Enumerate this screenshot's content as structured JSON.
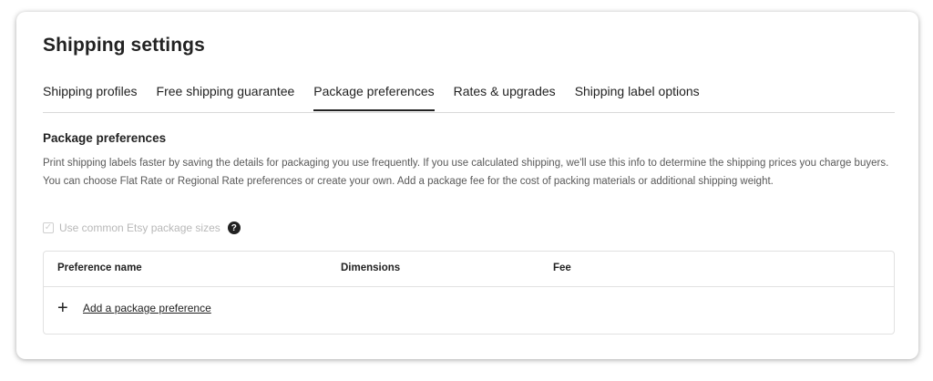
{
  "page": {
    "title": "Shipping settings"
  },
  "tabs": [
    {
      "label": "Shipping profiles",
      "active": false
    },
    {
      "label": "Free shipping guarantee",
      "active": false
    },
    {
      "label": "Package preferences",
      "active": true
    },
    {
      "label": "Rates & upgrades",
      "active": false
    },
    {
      "label": "Shipping label options",
      "active": false
    }
  ],
  "section": {
    "title": "Package preferences",
    "description": "Print shipping labels faster by saving the details for packaging you use frequently. If you use calculated shipping, we'll use this info to determine the shipping prices you charge buyers. You can choose Flat Rate or Regional Rate preferences or create your own. Add a package fee for the cost of packing materials or additional shipping weight."
  },
  "common_sizes": {
    "label": "Use common Etsy package sizes",
    "checked": true,
    "disabled": true,
    "help_icon": "question-circle-icon"
  },
  "table": {
    "columns": [
      "Preference name",
      "Dimensions",
      "Fee"
    ],
    "rows": [],
    "add_label": "Add a package preference",
    "add_icon": "plus-icon"
  },
  "colors": {
    "text": "#222222",
    "muted_text": "#595959",
    "disabled_text": "#b8b8b8",
    "border": "#e1e1e1"
  }
}
